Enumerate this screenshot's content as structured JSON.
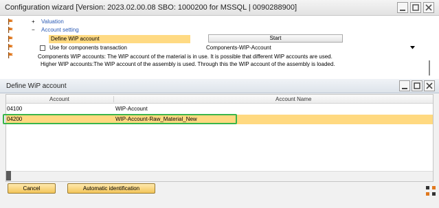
{
  "wizard": {
    "title": "Configuration wizard [Version: 2023.02.00.08 SBO: 1000200 for MSSQL | 0090288900]",
    "tree": [
      {
        "toggle": "+",
        "label": "Valuation"
      },
      {
        "toggle": "−",
        "label": "Account setting"
      }
    ],
    "define_wip_label": "Define WIP account",
    "start_label": "Start",
    "use_for_components_label": "Use for components transaction",
    "components_selected": "Components-WIP-Account",
    "description_1": "Components WIP accounts: The WIP account of the material is in use. It is possible that different WIP accounts are used.",
    "description_2": "Higher WIP accounts:The WIP account of the assembly is used. Through this the WIP account of the assembly is loaded."
  },
  "dialog": {
    "title": "Define WiP account",
    "columns": [
      "Account",
      "Account Name"
    ],
    "rows": [
      {
        "account": "04100",
        "name": "WIP-Account"
      },
      {
        "account": "04200",
        "name": "WIP-Account-Raw_Material_New"
      }
    ],
    "selected_row": 1,
    "cancel_label": "Cancel",
    "auto_id_label": "Automatic identification"
  },
  "colors": {
    "selection": "#ffd980",
    "highlight_border": "#39b54a",
    "flag": "#e0781e",
    "link": "#2a5ab4"
  }
}
